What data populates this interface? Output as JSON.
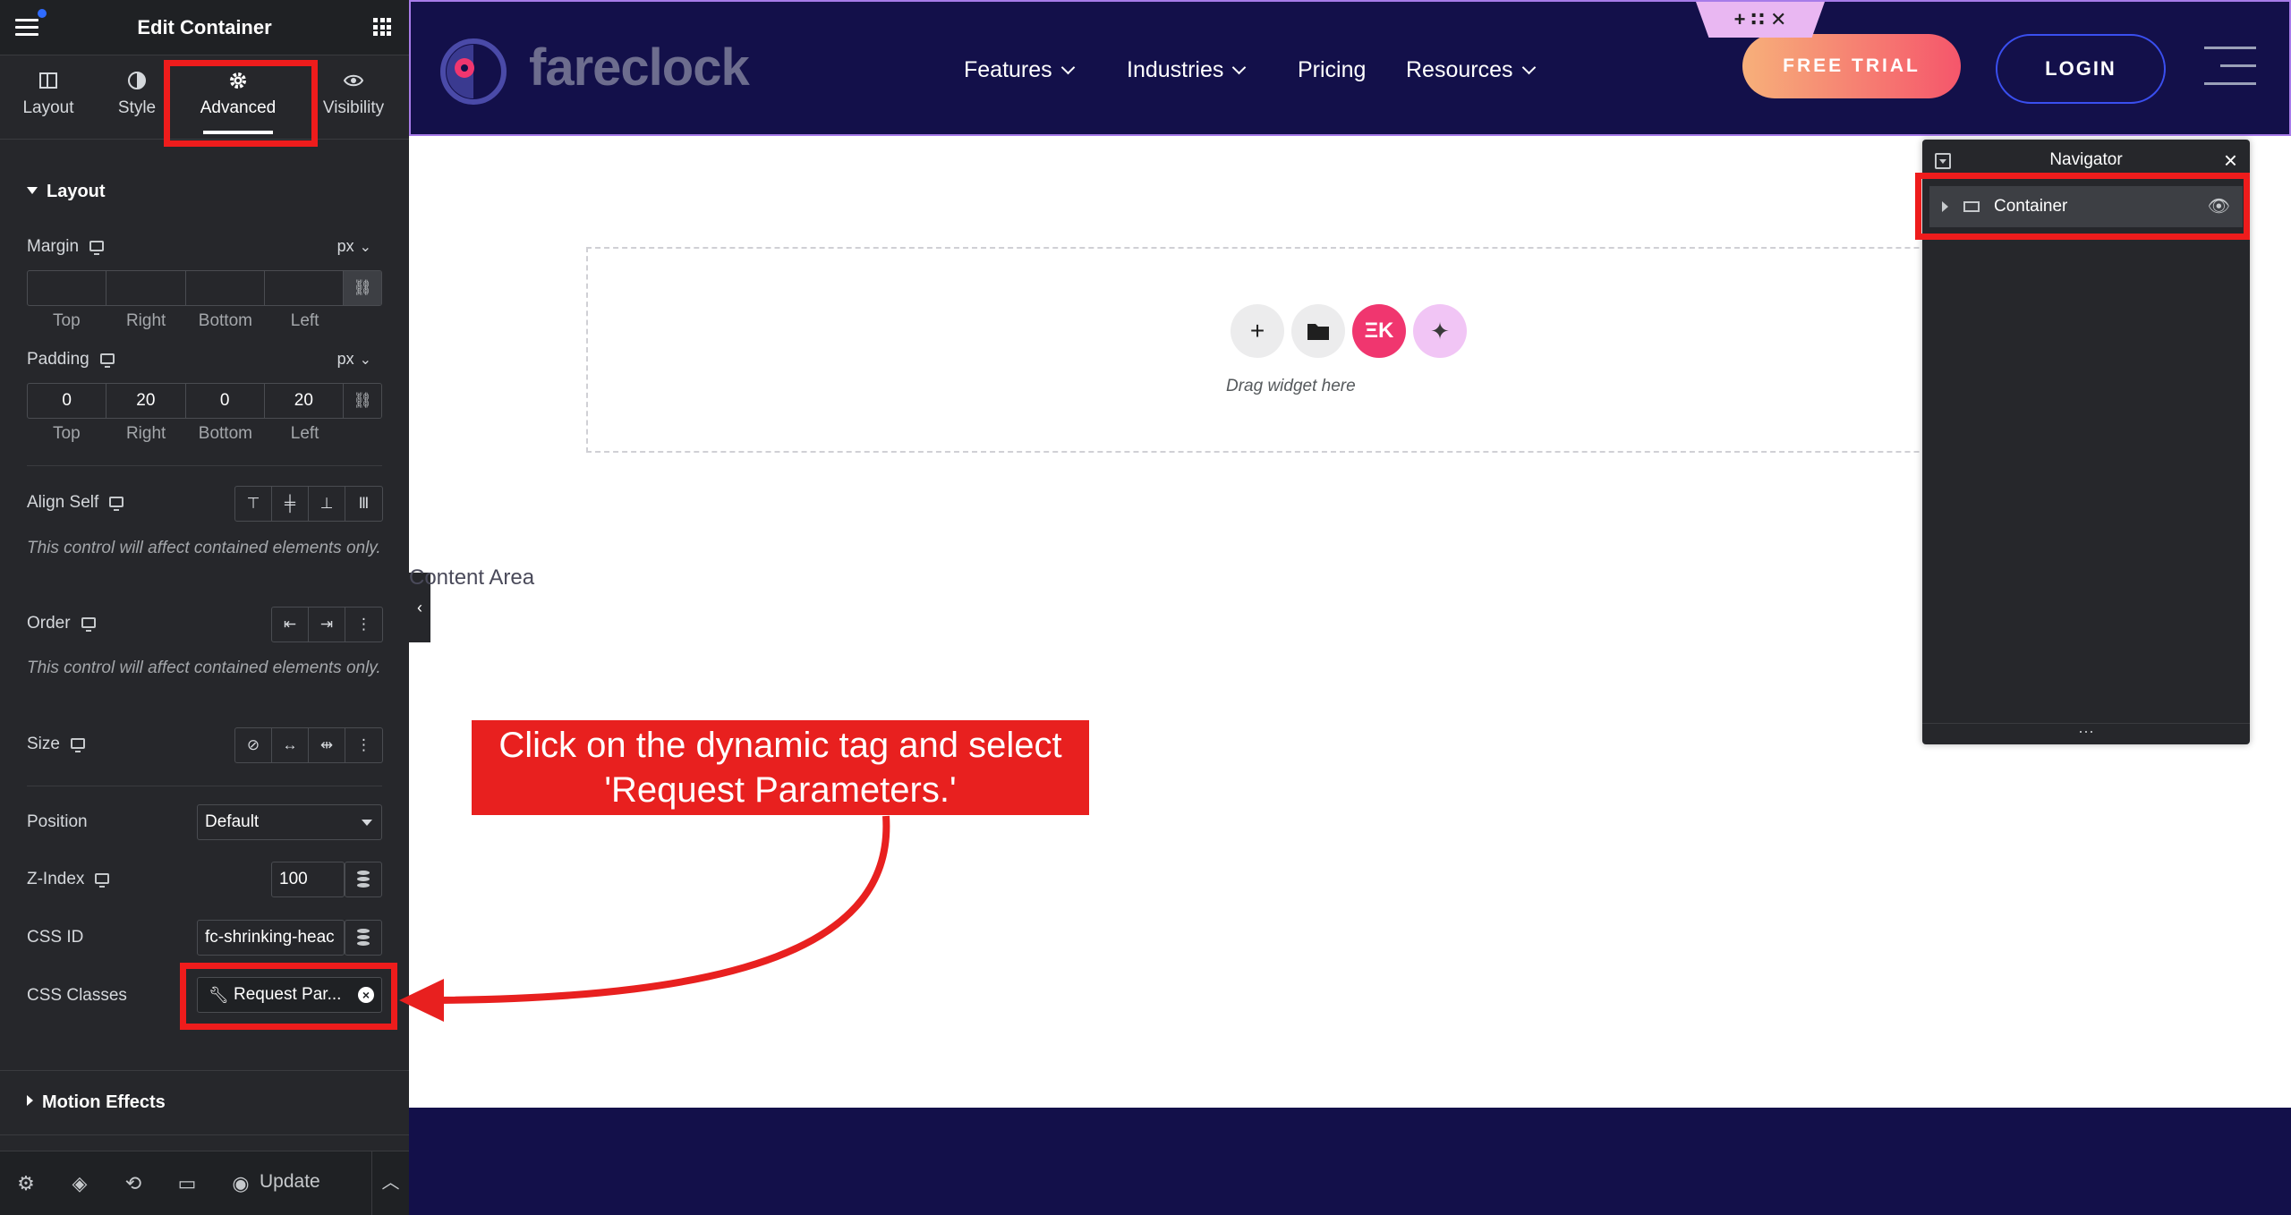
{
  "panel": {
    "title": "Edit Container",
    "tabs": [
      {
        "label": "Layout",
        "icon": "layout-icon"
      },
      {
        "label": "Style",
        "icon": "style-icon"
      },
      {
        "label": "Advanced",
        "icon": "gear-icon",
        "active": true
      },
      {
        "label": "Visibility",
        "icon": "eye-icon"
      }
    ],
    "layout_section": "Layout",
    "margin": {
      "label": "Margin",
      "unit": "px",
      "values": [
        "",
        "",
        "",
        ""
      ]
    },
    "padding": {
      "label": "Padding",
      "unit": "px",
      "values": [
        "0",
        "20",
        "0",
        "20"
      ]
    },
    "side_labels": [
      "Top",
      "Right",
      "Bottom",
      "Left"
    ],
    "align_self": {
      "label": "Align Self"
    },
    "contained_note": "This control will affect contained elements only.",
    "order": {
      "label": "Order"
    },
    "size": {
      "label": "Size"
    },
    "position": {
      "label": "Position",
      "value": "Default"
    },
    "zindex": {
      "label": "Z-Index",
      "value": "100"
    },
    "css_id": {
      "label": "CSS ID",
      "value": "fc-shrinking-heac"
    },
    "css_classes": {
      "label": "CSS Classes",
      "value": "Request Par..."
    },
    "motion_section": "Motion Effects",
    "update_label": "Update"
  },
  "header": {
    "logo_text": "fareclock",
    "nav": [
      "Features",
      "Industries",
      "Pricing",
      "Resources"
    ],
    "free_trial": "FREE TRIAL",
    "login": "LOGIN",
    "handle_icons": "+ ∷ ✕"
  },
  "canvas": {
    "drag_text": "Drag widget here",
    "content_area": "Content Area"
  },
  "navigator": {
    "title": "Navigator",
    "item": "Container"
  },
  "annotation": {
    "line1": "Click on the dynamic tag and select",
    "line2": "'Request Parameters.'",
    "color": "#e8201f"
  },
  "colors": {
    "panel_bg": "#26272b",
    "header_bg": "#13104a",
    "accent_pink": "#f0366f"
  }
}
